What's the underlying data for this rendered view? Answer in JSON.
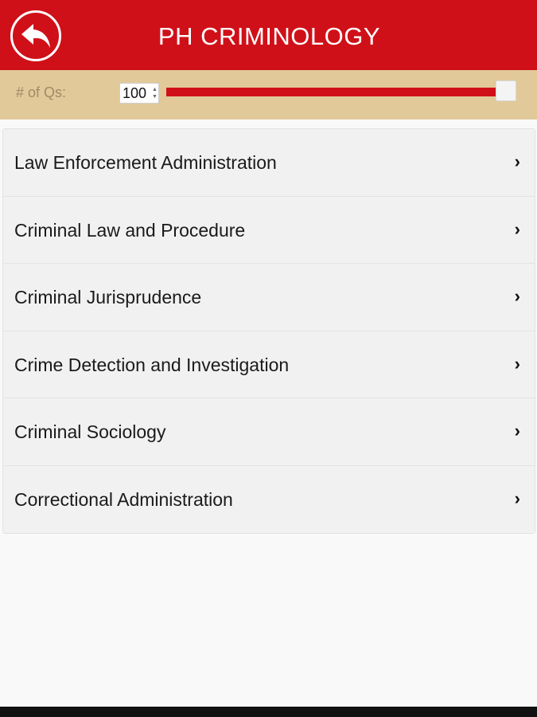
{
  "header": {
    "title": "PH CRIMINOLOGY",
    "back_icon": "reply-arrow-icon",
    "bg_color": "#d01018"
  },
  "toolbar": {
    "qs_label": "# of Qs:",
    "qs_value": "100",
    "slider_value_fraction": 1.0,
    "bg_color": "#e2c99a"
  },
  "subjects": [
    {
      "label": "Law Enforcement Administration"
    },
    {
      "label": "Criminal Law and Procedure"
    },
    {
      "label": "Criminal Jurisprudence"
    },
    {
      "label": "Crime Detection and Investigation"
    },
    {
      "label": "Criminal Sociology"
    },
    {
      "label": "Correctional Administration"
    }
  ],
  "chevron_glyph": "›"
}
